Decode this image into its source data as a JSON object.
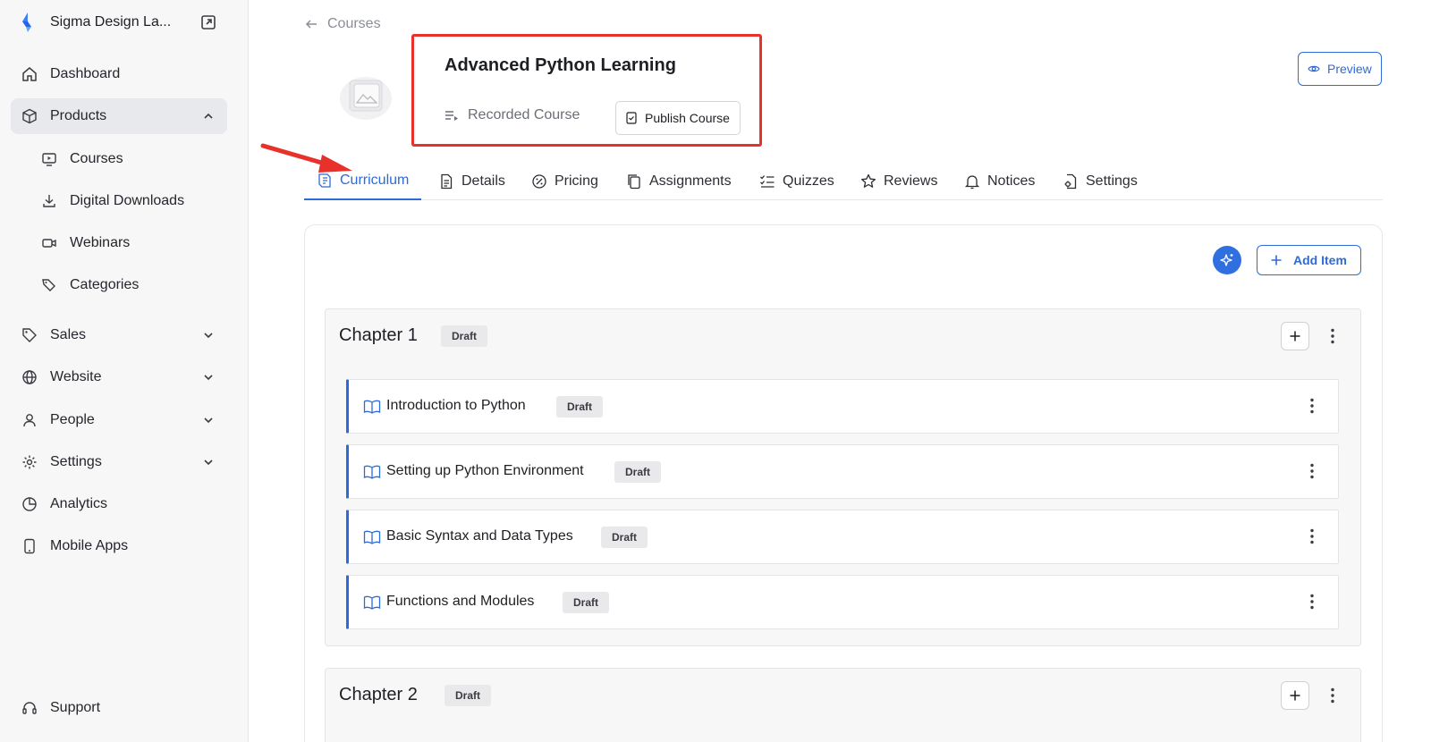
{
  "sidebar": {
    "brand": "Sigma Design La...",
    "items": [
      {
        "label": "Dashboard"
      },
      {
        "label": "Products"
      },
      {
        "label": "Sales"
      },
      {
        "label": "Website"
      },
      {
        "label": "People"
      },
      {
        "label": "Settings"
      },
      {
        "label": "Analytics"
      },
      {
        "label": "Mobile Apps"
      }
    ],
    "product_subitems": [
      {
        "label": "Courses"
      },
      {
        "label": "Digital Downloads"
      },
      {
        "label": "Webinars"
      },
      {
        "label": "Categories"
      }
    ],
    "support": "Support"
  },
  "header": {
    "back_label": "Courses",
    "course_title": "Advanced Python Learning",
    "course_type": "Recorded Course",
    "publish_label": "Publish Course",
    "preview_label": "Preview"
  },
  "tabs": [
    {
      "label": "Curriculum"
    },
    {
      "label": "Details"
    },
    {
      "label": "Pricing"
    },
    {
      "label": "Assignments"
    },
    {
      "label": "Quizzes"
    },
    {
      "label": "Reviews"
    },
    {
      "label": "Notices"
    },
    {
      "label": "Settings"
    }
  ],
  "toolbar": {
    "add_item_label": "Add Item"
  },
  "chapters": [
    {
      "title": "Chapter 1",
      "status": "Draft",
      "lessons": [
        {
          "title": "Introduction to Python",
          "status": "Draft"
        },
        {
          "title": "Setting up Python Environment",
          "status": "Draft"
        },
        {
          "title": "Basic Syntax and Data Types",
          "status": "Draft"
        },
        {
          "title": "Functions and Modules",
          "status": "Draft"
        }
      ]
    },
    {
      "title": "Chapter 2",
      "status": "Draft"
    }
  ],
  "colors": {
    "accent": "#2d6bd8",
    "highlight": "#e8312b",
    "sidebar_bg": "#f7f7f8"
  }
}
